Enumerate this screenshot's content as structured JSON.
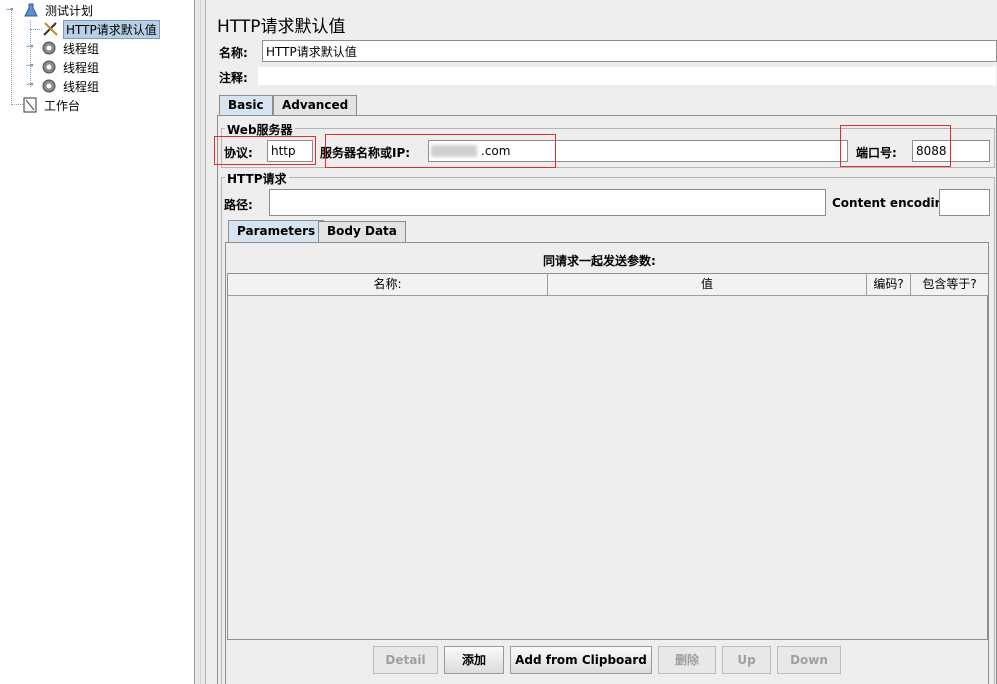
{
  "tree": {
    "items": [
      {
        "label": "测试计划",
        "icon": "flask-icon"
      },
      {
        "label": "HTTP请求默认值",
        "icon": "wrench-icon"
      },
      {
        "label": "线程组",
        "icon": "gear-icon"
      },
      {
        "label": "线程组",
        "icon": "gear-icon"
      },
      {
        "label": "线程组",
        "icon": "gear-icon"
      },
      {
        "label": "工作台",
        "icon": "workbench-icon"
      }
    ]
  },
  "main": {
    "title": "HTTP请求默认值",
    "name_label": "名称:",
    "name_value": "HTTP请求默认值",
    "comment_label": "注释:",
    "comment_value": "",
    "tabs": [
      {
        "label": "Basic"
      },
      {
        "label": "Advanced"
      }
    ],
    "web_server": {
      "group_title": "Web服务器",
      "protocol_label": "协议:",
      "protocol_value": "http",
      "server_label": "服务器名称或IP:",
      "server_value": ".com",
      "port_label": "端口号:",
      "port_value": "8088"
    },
    "http_request": {
      "group_title": "HTTP请求",
      "path_label": "路径:",
      "path_value": "",
      "encoding_label": "Content encoding:",
      "encoding_value": ""
    },
    "sub_tabs": [
      {
        "label": "Parameters"
      },
      {
        "label": "Body Data"
      }
    ],
    "params": {
      "heading": "同请求一起发送参数:",
      "columns": [
        "名称:",
        "值",
        "编码?",
        "包含等于?"
      ]
    },
    "buttons": {
      "detail": "Detail",
      "add": "添加",
      "add_clipboard": "Add from Clipboard",
      "delete": "删除",
      "up": "Up",
      "down": "Down"
    }
  },
  "colors": {
    "highlight_box": "#e0302c",
    "selected_bg": "#b8cfe5",
    "tab_active": "#d6e4f2"
  }
}
